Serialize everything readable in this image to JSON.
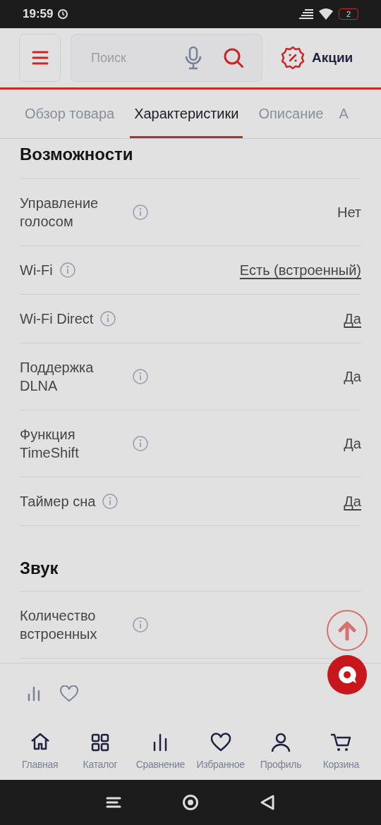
{
  "status_bar": {
    "time": "19:59",
    "battery": "2"
  },
  "header": {
    "search": {
      "placeholder": "Поиск"
    },
    "promo": "Акции"
  },
  "tabs": [
    {
      "label": "Обзор товара",
      "selected": false
    },
    {
      "label": "Характеристики",
      "selected": true
    },
    {
      "label": "Описание",
      "selected": false
    },
    {
      "label": "А",
      "selected": false
    }
  ],
  "sections": [
    {
      "title": "Возможности",
      "rows": [
        {
          "label": "Управление голосом",
          "value": "Нет",
          "underlined": false
        },
        {
          "label": "Wi-Fi",
          "value": "Есть (встроенный)",
          "underlined": true
        },
        {
          "label": "Wi-Fi Direct",
          "value": "Да",
          "underlined": true
        },
        {
          "label": "Поддержка DLNA",
          "value": "Да",
          "underlined": false
        },
        {
          "label": "Функция TimeShift",
          "value": "Да",
          "underlined": false
        },
        {
          "label": "Таймер сна",
          "value": "Да",
          "underlined": true
        }
      ]
    },
    {
      "title": "Звук",
      "rows": [
        {
          "label": "Количество встроенных"
        }
      ]
    }
  ],
  "bottom_nav": [
    {
      "label": "Главная"
    },
    {
      "label": "Каталог"
    },
    {
      "label": "Сравнение"
    },
    {
      "label": "Избранное"
    },
    {
      "label": "Профиль"
    },
    {
      "label": "Корзина"
    }
  ]
}
